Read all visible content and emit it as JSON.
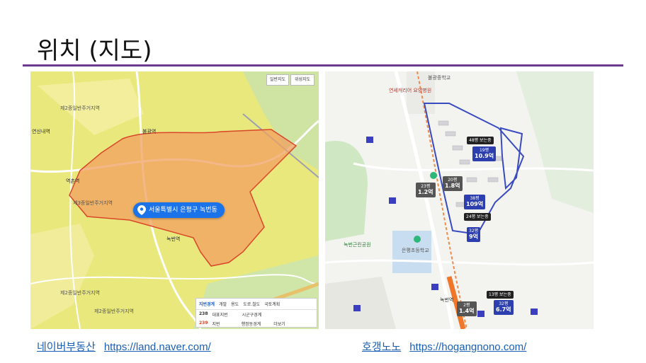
{
  "title": "위치 (지도)",
  "left_map": {
    "toggle_general": "일반지도",
    "toggle_satellite": "위성지도",
    "pin_label": "서울특별시 은평구 녹번동",
    "labels": {
      "zone1": "제2종일반주거지역",
      "zone2": "제3종일반주거지역",
      "zone3": "제2종일반주거지역",
      "zone4": "제2종일반주거지역",
      "station1": "불광역",
      "station2": "녹번역",
      "station3": "역촌역",
      "station4": "연신내역"
    },
    "legend": {
      "tabs": [
        "지번경계",
        "개발",
        "용도",
        "도로.철도",
        "국토계획"
      ],
      "row1_num": "238",
      "row1_label": "대표지번",
      "row1_right": "시군구경계",
      "row2_num": "239",
      "row2_label": "지번",
      "row2_right": "행정동경계",
      "more": "더보기"
    }
  },
  "right_map": {
    "labels": {
      "school": "불광중학교",
      "park": "녹번근린공원",
      "elementary": "은평초등학교",
      "station": "녹번역",
      "hospital": "연세캐리어 요양병원"
    },
    "tags": {
      "t1_head": "48평 보는중",
      "t1_sub": "19평",
      "t1_price": "10.9억",
      "t2_sub": "23평",
      "t2_price": "1.2억",
      "t3_sub": "20평",
      "t3_price": "1.8억",
      "t4_head": "38평",
      "t4_price": "109억",
      "t5_head": "24평 보는중",
      "t6_sub": "32평",
      "t6_price": "9억",
      "t7_head": "13평 보는중",
      "t7_sub": "32평",
      "t7_price": "6.7억",
      "t8_sub": "2평",
      "t8_price": "1.4억"
    }
  },
  "captions": {
    "left_name": "네이버부동산",
    "left_url": "https://land.naver.com/",
    "right_name": "호갱노노",
    "right_url": "https://hogangnono.com/"
  },
  "colors": {
    "accent_rule": "#6b3a8f",
    "link": "#1a5fb4",
    "region_fill": "#f0a060",
    "region_stroke": "#d9462a",
    "complex_outline": "#3a4bc0"
  }
}
